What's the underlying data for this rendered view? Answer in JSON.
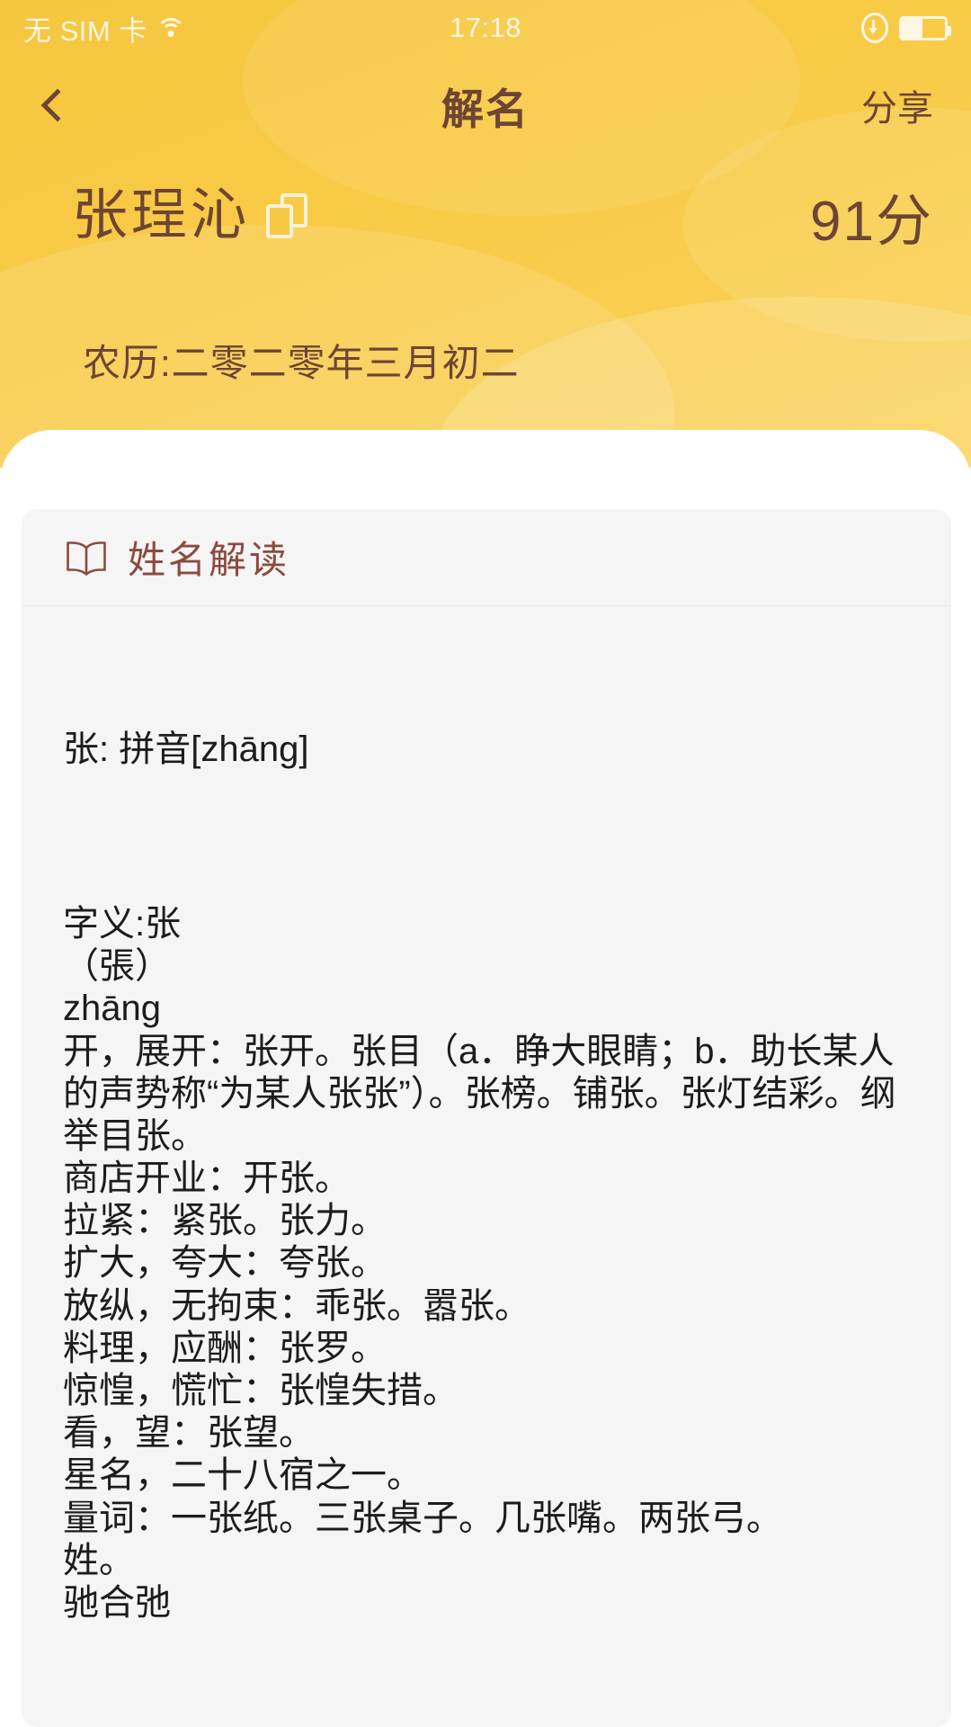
{
  "status_bar": {
    "carrier": "无 SIM 卡",
    "wifi_icon": "wifi-icon",
    "time": "17:18",
    "rotation_lock_icon": "rotation-lock-icon",
    "battery_icon": "battery-icon",
    "battery_level_percent": 48
  },
  "nav": {
    "back_icon": "chevron-left-icon",
    "title": "解名",
    "share_label": "分享"
  },
  "header": {
    "name": "张珵沁",
    "copy_icon": "copy-icon",
    "score": "91分",
    "lunar_date": "农历:二零二零年三月初二"
  },
  "card": {
    "icon": "open-book-icon",
    "title": "姓名解读",
    "pinyin_line": "张: 拼音[zhāng]",
    "meaning_block": "字义:张\n（張）\nzhāng\n开，展开：张开。张目（a．睁大眼睛；b．助长某人的声势称“为某人张张”）。张榜。铺张。张灯结彩。纲举目张。\n商店开业：开张。\n拉紧：紧张。张力。\n扩大，夸大：夸张。\n放纵，无拘束：乖张。嚣张。\n料理，应酬：张罗。\n惊惶，慌忙：张惶失措。\n看，望：张望。\n星名，二十八宿之一。\n量词：一张纸。三张桌子。几张嘴。两张弓。\n姓。\n驰合弛"
  },
  "colors": {
    "hero_yellow": "#f7c843",
    "header_brown": "#6e4534",
    "card_title_brown": "#8c4a3f",
    "card_bg": "#f5f5f5",
    "sheet_bg": "#ffffff",
    "body_text": "#1c1c1c"
  }
}
